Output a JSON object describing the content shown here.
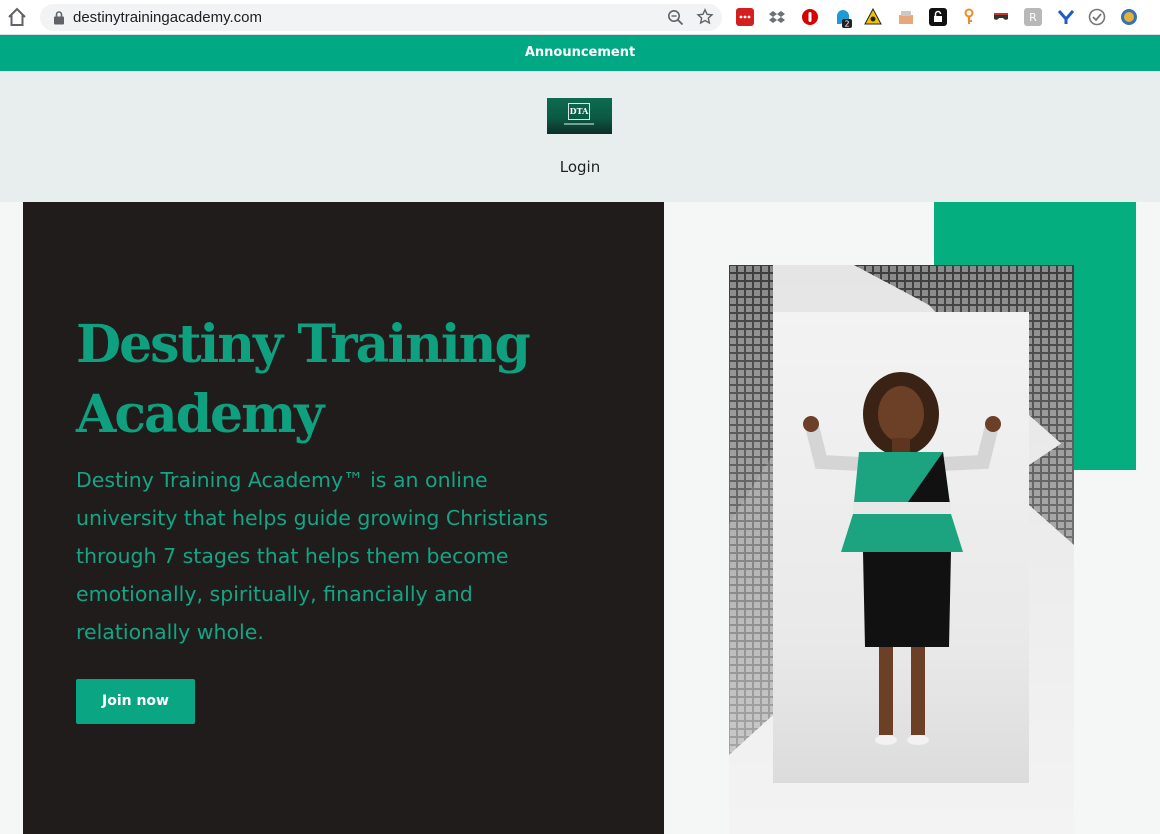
{
  "browser": {
    "url": "destinytrainingacademy.com",
    "extension_badge": "2"
  },
  "announcement": {
    "text": "Announcement"
  },
  "header": {
    "logo_text": "DTA",
    "login_label": "Login"
  },
  "hero": {
    "title": "Destiny Training Academy",
    "description": "Destiny Training Academy™ is an online university that helps guide growing Christians through 7 stages that helps them become emotionally, spiritually, financially and relationally whole.",
    "cta_label": "Join now"
  },
  "colors": {
    "brand_green": "#00a884",
    "hero_dark": "#201c1b",
    "accent_green": "#04ae7f"
  },
  "icons": {
    "home": "home-icon",
    "lock": "lock-icon",
    "zoom": "zoom-icon",
    "star": "star-icon"
  }
}
